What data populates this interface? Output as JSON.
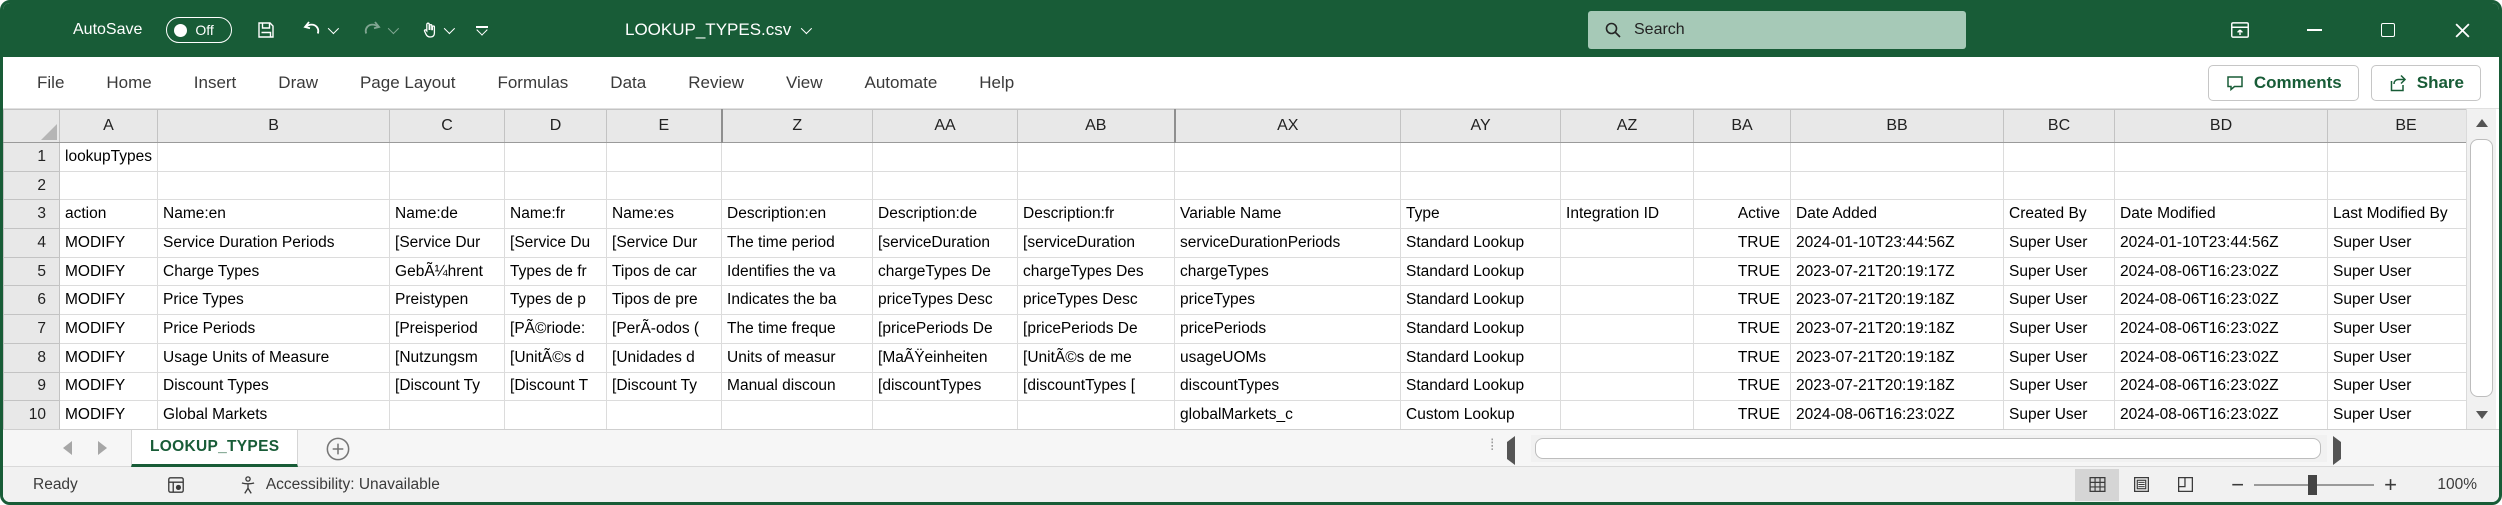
{
  "title_bar": {
    "autosave_label": "AutoSave",
    "autosave_state": "Off",
    "document_title": "LOOKUP_TYPES.csv",
    "search_placeholder": "Search"
  },
  "ribbon": {
    "tabs": [
      "File",
      "Home",
      "Insert",
      "Draw",
      "Page Layout",
      "Formulas",
      "Data",
      "Review",
      "View",
      "Automate",
      "Help"
    ],
    "comments_label": "Comments",
    "share_label": "Share"
  },
  "grid": {
    "column_letters": [
      "A",
      "B",
      "C",
      "D",
      "E",
      "Z",
      "AA",
      "AB",
      "AX",
      "AY",
      "AZ",
      "BA",
      "BB",
      "BC",
      "BD",
      "BE"
    ],
    "hidden_break_columns": [
      "Z",
      "AX"
    ],
    "rows": [
      {
        "num": "1",
        "cells": [
          "lookupTypes",
          "",
          "",
          "",
          "",
          "",
          "",
          "",
          "",
          "",
          "",
          "",
          "",
          "",
          "",
          ""
        ]
      },
      {
        "num": "2",
        "cells": [
          "",
          "",
          "",
          "",
          "",
          "",
          "",
          "",
          "",
          "",
          "",
          "",
          "",
          "",
          "",
          ""
        ]
      },
      {
        "num": "3",
        "cells": [
          "action",
          "Name:en",
          "Name:de",
          "Name:fr",
          "Name:es",
          "Description:en",
          "Description:de",
          "Description:fr",
          "Variable Name",
          "Type",
          "Integration ID",
          "Active",
          "Date Added",
          "Created By",
          "Date Modified",
          "Last Modified By"
        ]
      },
      {
        "num": "4",
        "cells": [
          "MODIFY",
          "Service Duration Periods",
          "[Service Dur",
          "[Service Du",
          "[Service Dur",
          "The time period",
          "[serviceDuration",
          "[serviceDuration",
          "serviceDurationPeriods",
          "Standard Lookup",
          "",
          "TRUE",
          "2024-01-10T23:44:56Z",
          "Super User",
          "2024-01-10T23:44:56Z",
          "Super User"
        ]
      },
      {
        "num": "5",
        "cells": [
          "MODIFY",
          "Charge Types",
          "GebÃ¼hrent",
          "Types de fr",
          "Tipos de car",
          "Identifies the va",
          "chargeTypes De",
          "chargeTypes Des",
          "chargeTypes",
          "Standard Lookup",
          "",
          "TRUE",
          "2023-07-21T20:19:17Z",
          "Super User",
          "2024-08-06T16:23:02Z",
          "Super User"
        ]
      },
      {
        "num": "6",
        "cells": [
          "MODIFY",
          "Price Types",
          "Preistypen",
          "Types de p",
          "Tipos de pre",
          "Indicates the ba",
          "priceTypes Desc",
          "priceTypes Desc",
          "priceTypes",
          "Standard Lookup",
          "",
          "TRUE",
          "2023-07-21T20:19:18Z",
          "Super User",
          "2024-08-06T16:23:02Z",
          "Super User"
        ]
      },
      {
        "num": "7",
        "cells": [
          "MODIFY",
          "Price Periods",
          "[Preisperiod",
          "[PÃ©riode:",
          "[PerÃ-odos (",
          "The time freque",
          "[pricePeriods De",
          "[pricePeriods De",
          "pricePeriods",
          "Standard Lookup",
          "",
          "TRUE",
          "2023-07-21T20:19:18Z",
          "Super User",
          "2024-08-06T16:23:02Z",
          "Super User"
        ]
      },
      {
        "num": "8",
        "cells": [
          "MODIFY",
          "Usage Units of Measure",
          "[Nutzungsm",
          "[UnitÃ©s d",
          "[Unidades d",
          "Units of measur",
          "[MaÃŸeinheiten",
          "[UnitÃ©s de me",
          "usageUOMs",
          "Standard Lookup",
          "",
          "TRUE",
          "2023-07-21T20:19:18Z",
          "Super User",
          "2024-08-06T16:23:02Z",
          "Super User"
        ]
      },
      {
        "num": "9",
        "cells": [
          "MODIFY",
          "Discount Types",
          "[Discount Ty",
          "[Discount T",
          "[Discount Ty",
          "Manual discoun",
          "[discountTypes",
          "[discountTypes [",
          "discountTypes",
          "Standard Lookup",
          "",
          "TRUE",
          "2023-07-21T20:19:18Z",
          "Super User",
          "2024-08-06T16:23:02Z",
          "Super User"
        ]
      },
      {
        "num": "10",
        "cells": [
          "MODIFY",
          "Global Markets",
          "",
          "",
          "",
          "",
          "",
          "",
          "globalMarkets_c",
          "Custom Lookup",
          "",
          "TRUE",
          "2024-08-06T16:23:02Z",
          "Super User",
          "2024-08-06T16:23:02Z",
          "Super User"
        ]
      }
    ]
  },
  "sheet_bar": {
    "active_sheet": "LOOKUP_TYPES"
  },
  "status_bar": {
    "ready_label": "Ready",
    "accessibility_label": "Accessibility: Unavailable",
    "zoom_level": "100%"
  },
  "colors": {
    "titlebar_green": "#185c37",
    "accent_green": "#185c37",
    "search_bg": "#a6c9b7"
  }
}
